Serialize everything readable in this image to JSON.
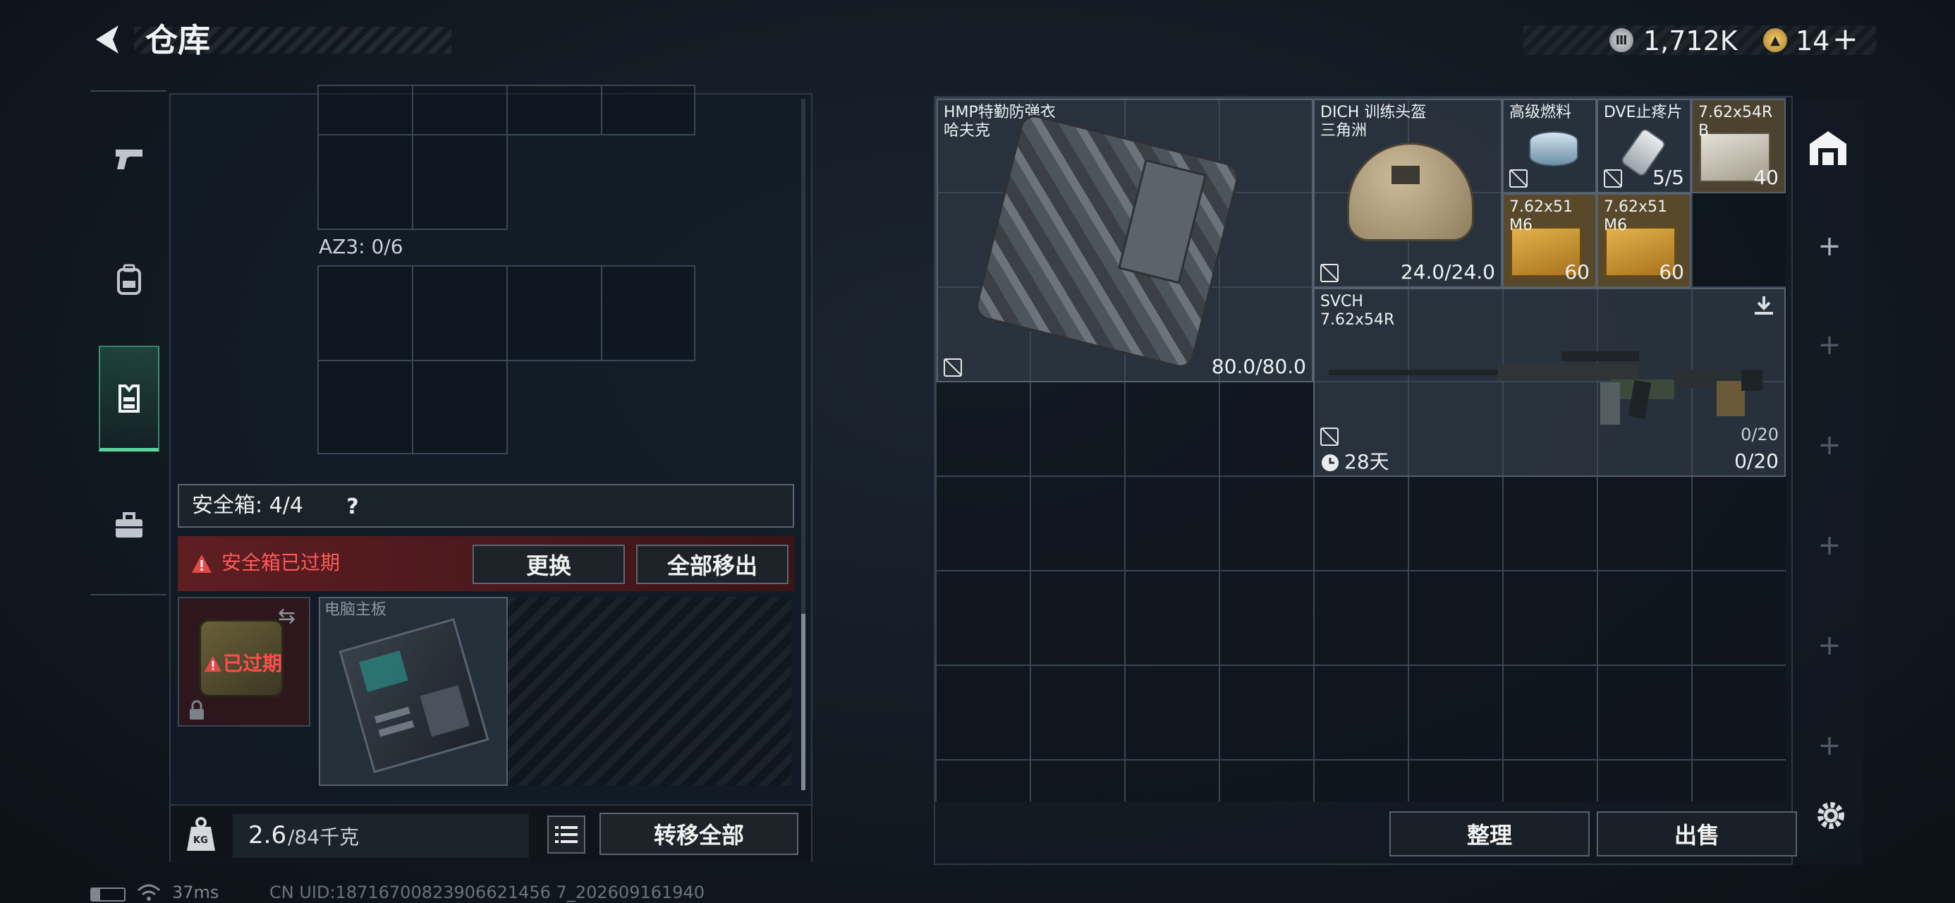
{
  "header": {
    "title": "仓库",
    "silver_amount": "1,712K",
    "gold_amount": "14",
    "gold_plus": "+"
  },
  "sidebar": {
    "items": [
      {
        "icon": "pistol-icon",
        "active": false
      },
      {
        "icon": "backpack-icon",
        "active": false
      },
      {
        "icon": "chest-rig-icon",
        "active": true
      },
      {
        "icon": "briefcase-icon",
        "active": false
      }
    ]
  },
  "left_panel": {
    "section_label": "AZ3: 0/6",
    "safe_box_label": "安全箱: 4/4",
    "help_symbol": "?",
    "warning_text": "安全箱已过期",
    "replace_button": "更换",
    "remove_all_button": "全部移出",
    "expired_badge": "已过期",
    "item_name": "电脑主板",
    "weight_value": "2.6",
    "weight_capacity": "/84千克",
    "weight_icon_label": "KG",
    "transfer_all_button": "转移全部"
  },
  "stash": {
    "items": [
      {
        "name_line1": "HMP特勤防弹衣",
        "name_line2": "哈夫克",
        "value": "80.0/80.0"
      },
      {
        "name_line1": "DICH 训练头盔",
        "name_line2": "三角洲",
        "value": "24.0/24.0"
      },
      {
        "name_line1": "高级燃料",
        "value": ""
      },
      {
        "name_line1": "DVE止疼片",
        "value": "5/5"
      },
      {
        "name_line1": "7.62x54R",
        "name_line2": "B",
        "value": "40"
      },
      {
        "name_line1": "7.62x51",
        "name_line2": "M6",
        "value": "60"
      },
      {
        "name_line1": "7.62x51",
        "name_line2": "M6",
        "value": "60"
      },
      {
        "name_line1": "SVCH",
        "name_line2": "7.62x54R",
        "ammo_small": "0/20",
        "ammo": "0/20",
        "timer": "28天"
      }
    ],
    "sort_button": "整理",
    "sell_button": "出售"
  },
  "status_bar": {
    "ping": "37ms",
    "uid": "CN UID:18716700823906621456 7_202609161940"
  },
  "colors": {
    "accent_green": "#5cd6a0",
    "warning_red": "#e24a4a",
    "ammo_gold": "#d9a441"
  }
}
